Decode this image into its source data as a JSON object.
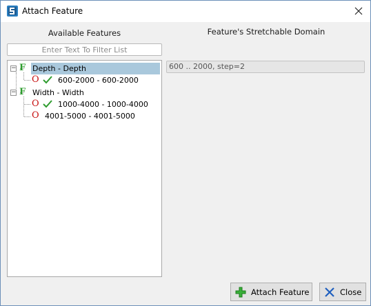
{
  "window": {
    "title": "Attach Feature",
    "icons": {
      "app": "app-icon",
      "close": "close-icon"
    }
  },
  "left_panel": {
    "heading": "Available Features",
    "filter_placeholder": "Enter Text To Filter List",
    "filter_value": "",
    "tree": [
      {
        "type": "feature",
        "glyph": "F",
        "label": "Depth - Depth",
        "expanded": true,
        "selected": true,
        "children": [
          {
            "type": "option",
            "glyph": "O",
            "checked": true,
            "label": "600-2000 - 600-2000"
          }
        ]
      },
      {
        "type": "feature",
        "glyph": "F",
        "label": "Width - Width",
        "expanded": true,
        "selected": false,
        "children": [
          {
            "type": "option",
            "glyph": "O",
            "checked": true,
            "label": "1000-4000 - 1000-4000"
          },
          {
            "type": "option",
            "glyph": "O",
            "checked": false,
            "label": "4001-5000 - 4001-5000"
          }
        ]
      }
    ],
    "expander_symbol": "−"
  },
  "right_panel": {
    "heading": "Feature's Stretchable Domain",
    "domain_value": "600 .. 2000, step=2"
  },
  "buttons": {
    "attach": {
      "label": "Attach Feature",
      "icon": "plus-icon"
    },
    "close": {
      "label": "Close",
      "icon": "close-icon"
    }
  },
  "colors": {
    "feature_glyph": "#2e9c2e",
    "option_glyph": "#c81414",
    "check": "#2e9c2e",
    "selection": "#a9c8dc",
    "attach_icon": "#2e9c2e",
    "close_icon": "#1f5fbf"
  }
}
